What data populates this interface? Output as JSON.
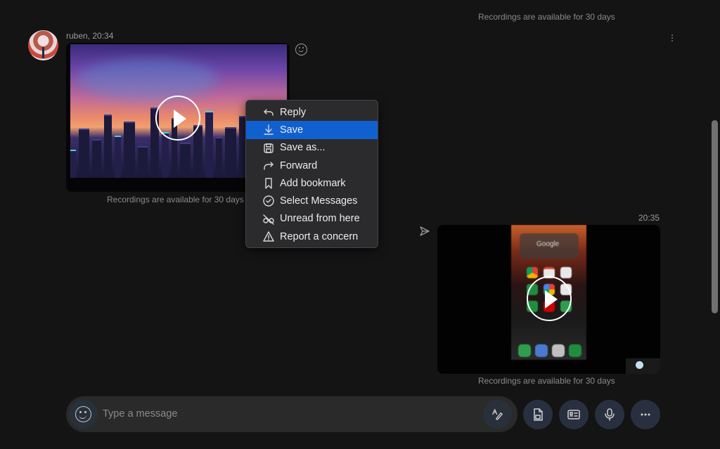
{
  "chat": {
    "retention_note": "Recordings are available for 30 days",
    "messages": [
      {
        "sender": "ruben, 20:34",
        "type": "video-recording",
        "thumbnail": "city skyline at dusk",
        "note": "Recordings are available for 30 days"
      },
      {
        "sender_time": "20:35",
        "type": "video-recording",
        "thumbnail": "phone home screen recording",
        "thumbnail_label": "Google",
        "status_icon": "sent-icon",
        "note": "Recordings are available for 30 days"
      }
    ]
  },
  "context_menu": {
    "items": [
      {
        "label": "Reply",
        "icon": "reply-icon",
        "active": false
      },
      {
        "label": "Save",
        "icon": "download-icon",
        "active": true
      },
      {
        "label": "Save as...",
        "icon": "save-disk-icon",
        "active": false
      },
      {
        "label": "Forward",
        "icon": "forward-icon",
        "active": false
      },
      {
        "label": "Add bookmark",
        "icon": "bookmark-icon",
        "active": false
      },
      {
        "label": "Select Messages",
        "icon": "check-circle-icon",
        "active": false
      },
      {
        "label": "Unread from here",
        "icon": "glasses-off-icon",
        "active": false
      },
      {
        "label": "Report a concern",
        "icon": "warning-icon",
        "active": false
      }
    ]
  },
  "composer": {
    "placeholder": "Type a message",
    "value": "",
    "buttons": [
      "emoji-icon",
      "format-icon",
      "media-file-icon",
      "contact-card-icon",
      "microphone-icon",
      "more-icon"
    ]
  },
  "colors": {
    "background": "#141414",
    "menu_bg": "#2b2b2d",
    "menu_active": "#1160d0",
    "button_bg": "#283040"
  }
}
